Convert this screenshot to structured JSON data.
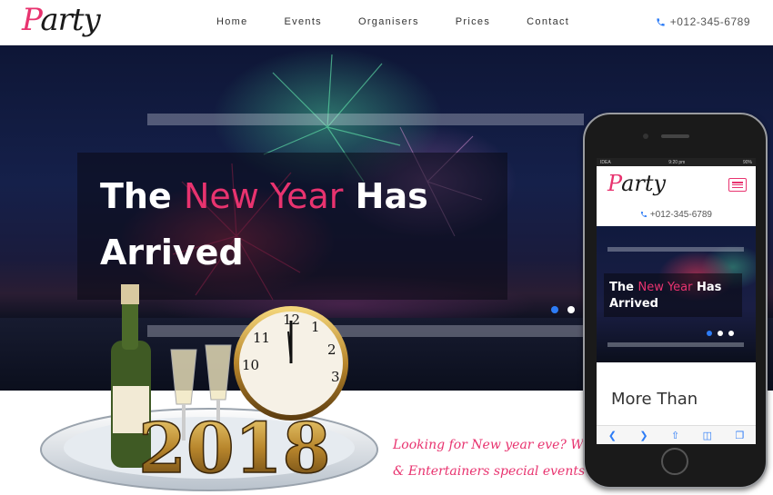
{
  "brand": {
    "logo_first": "P",
    "logo_rest": "arty",
    "accent": "#e8336f"
  },
  "nav": {
    "items": [
      "Home",
      "Events",
      "Organisers",
      "Prices",
      "Contact"
    ],
    "phone": "+012-345-6789"
  },
  "hero": {
    "title_before": "The ",
    "title_accent": "New Year",
    "title_after": " Has",
    "title_line2": "Arrived",
    "active_slide": 1,
    "slide_count": 2
  },
  "decor": {
    "year": "2018",
    "clock_numbers": [
      "12",
      "1",
      "2",
      "3",
      "10",
      "11"
    ]
  },
  "tagline": {
    "line1": "Looking for New year eve? We have E",
    "line2": "& Entertainers special events waiting"
  },
  "mobile": {
    "status_carrier": "IDEA",
    "status_time": "9:20 pm",
    "status_battery": "90%",
    "logo_first": "P",
    "logo_rest": "arty",
    "phone": "+012-345-6789",
    "title_before": "The ",
    "title_accent": "New Year",
    "title_after": " Has",
    "title_line2": "Arrived",
    "more_heading": "More Than",
    "toolbar_icons": [
      "back-icon",
      "forward-icon",
      "share-icon",
      "bookmarks-icon",
      "tabs-icon"
    ]
  }
}
